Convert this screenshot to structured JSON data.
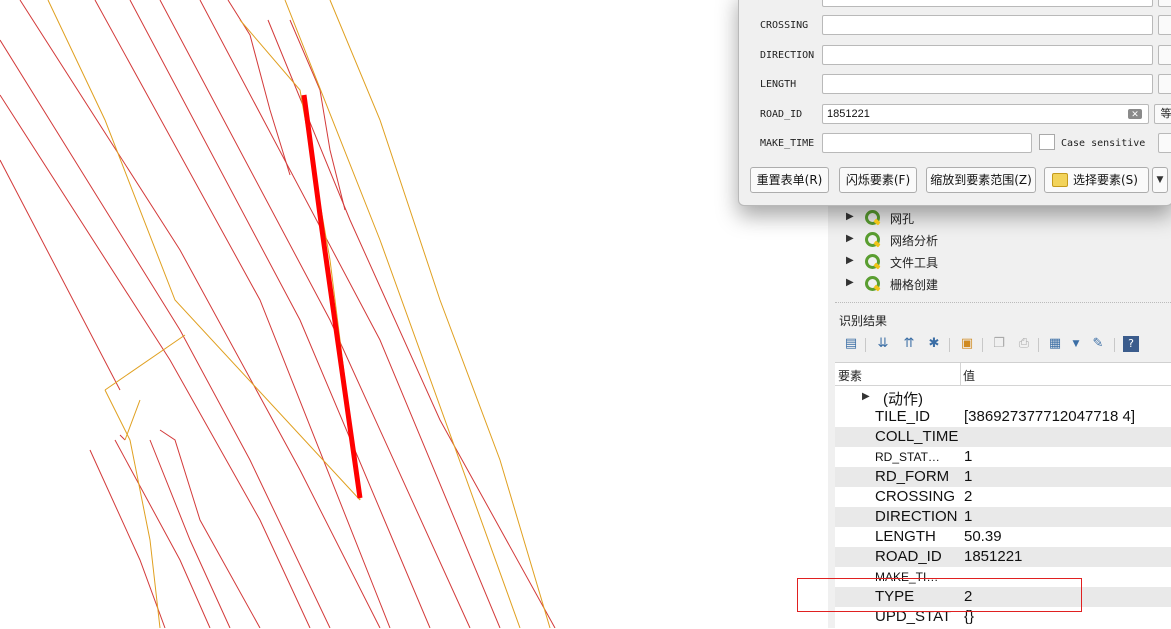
{
  "map": {
    "line_colors": {
      "road": "#d33a3a",
      "centerline": "#e0a020",
      "selected": "#ff0000"
    }
  },
  "tree": {
    "items": [
      {
        "label": "网孔"
      },
      {
        "label": "网络分析"
      },
      {
        "label": "文件工具"
      },
      {
        "label": "栅格创建"
      }
    ]
  },
  "identify": {
    "title": "识别结果",
    "columns": {
      "feature": "要素",
      "value": "值"
    },
    "actions_label": "(动作)",
    "rows": [
      {
        "key": "TILE_ID",
        "value": "[386927377712047718 4]"
      },
      {
        "key": "COLL_TIME",
        "value": ""
      },
      {
        "key": "RD_STAT…",
        "value": "1"
      },
      {
        "key": "RD_FORM",
        "value": "1"
      },
      {
        "key": "CROSSING",
        "value": "2"
      },
      {
        "key": "DIRECTION",
        "value": "1"
      },
      {
        "key": "LENGTH",
        "value": "50.39"
      },
      {
        "key": "ROAD_ID",
        "value": "1851221"
      },
      {
        "key": "MAKE_TI…",
        "value": ""
      },
      {
        "key": "TYPE",
        "value": "2"
      },
      {
        "key": "UPD_STAT",
        "value": "{}"
      }
    ],
    "highlight_color": "#e02020"
  },
  "dialog": {
    "fields": [
      {
        "label": "CROSSING",
        "value": ""
      },
      {
        "label": "DIRECTION",
        "value": ""
      },
      {
        "label": "LENGTH",
        "value": ""
      },
      {
        "label": "ROAD_ID",
        "value": "1851221"
      },
      {
        "label": "MAKE_TIME",
        "value": ""
      }
    ],
    "side_button": "等",
    "case_sensitive": "Case sensitive",
    "buttons": {
      "reset": "重置表单(R)",
      "flash": "闪烁要素(F)",
      "zoom": "缩放到要素范围(Z)",
      "select": "选择要素(S)"
    }
  }
}
